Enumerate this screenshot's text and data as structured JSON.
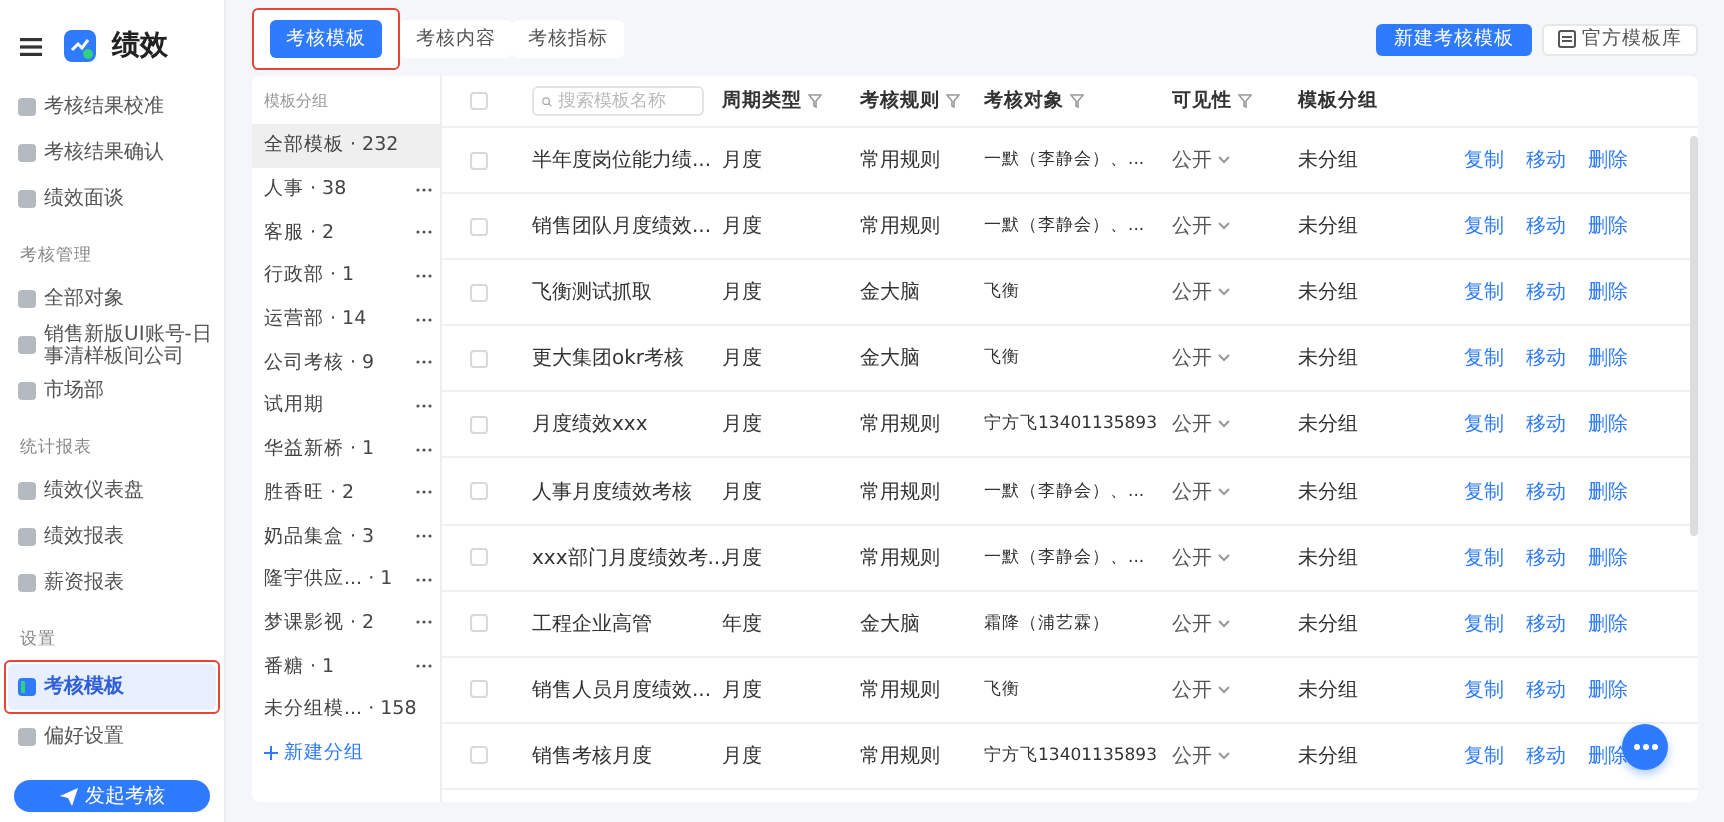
{
  "sidebar": {
    "title": "绩效",
    "items": [
      {
        "kind": "item",
        "label": "考核结果校准",
        "selected": false
      },
      {
        "kind": "item",
        "label": "考核结果确认",
        "selected": false
      },
      {
        "kind": "item",
        "label": "绩效面谈",
        "selected": false
      },
      {
        "kind": "section",
        "label": "考核管理"
      },
      {
        "kind": "item",
        "label": "全部对象",
        "selected": false
      },
      {
        "kind": "item",
        "label": "销售新版UI账号-日事清样板间公司",
        "selected": false
      },
      {
        "kind": "item",
        "label": "市场部",
        "selected": false
      },
      {
        "kind": "section",
        "label": "统计报表"
      },
      {
        "kind": "item",
        "label": "绩效仪表盘",
        "selected": false
      },
      {
        "kind": "item",
        "label": "绩效报表",
        "selected": false
      },
      {
        "kind": "item",
        "label": "薪资报表",
        "selected": false
      },
      {
        "kind": "section",
        "label": "设置"
      },
      {
        "kind": "item",
        "label": "考核模板",
        "selected": true
      },
      {
        "kind": "item",
        "label": "偏好设置",
        "selected": false
      }
    ],
    "button": "发起考核"
  },
  "tabs": [
    {
      "label": "考核模板",
      "selected": true
    },
    {
      "label": "考核内容",
      "selected": false
    },
    {
      "label": "考核指标",
      "selected": false
    }
  ],
  "toolbar": {
    "primary": "新建考核模板",
    "secondary": "官方模板库"
  },
  "groups": {
    "header": "模板分组",
    "items": [
      {
        "label": "全部模板 · 232",
        "selected": true,
        "menu": false
      },
      {
        "label": "人事 · 38",
        "selected": false,
        "menu": true
      },
      {
        "label": "客服 · 2",
        "selected": false,
        "menu": true
      },
      {
        "label": "行政部 · 1",
        "selected": false,
        "menu": true
      },
      {
        "label": "运营部 · 14",
        "selected": false,
        "menu": true
      },
      {
        "label": "公司考核 · 9",
        "selected": false,
        "menu": true
      },
      {
        "label": "试用期",
        "selected": false,
        "menu": true
      },
      {
        "label": "华益新桥 · 1",
        "selected": false,
        "menu": true
      },
      {
        "label": "胜香旺 · 2",
        "selected": false,
        "menu": true
      },
      {
        "label": "奶品集盒 · 3",
        "selected": false,
        "menu": true
      },
      {
        "label": "隆宇供应...  · 1",
        "selected": false,
        "menu": true
      },
      {
        "label": "梦课影视 · 2",
        "selected": false,
        "menu": true
      },
      {
        "label": "番糖 · 1",
        "selected": false,
        "menu": true
      },
      {
        "label": "未分组模... · 158",
        "selected": false,
        "menu": false
      }
    ],
    "add": "新建分组"
  },
  "table": {
    "select_all": false,
    "search": {
      "placeholder": "搜索模板名称"
    },
    "columns": [
      {
        "label": "周期类型",
        "filter": true
      },
      {
        "label": "考核规则",
        "filter": true
      },
      {
        "label": "考核对象",
        "filter": true
      },
      {
        "label": "可见性",
        "filter": true
      },
      {
        "label": "模板分组",
        "filter": false
      }
    ],
    "rows": [
      {
        "checked": false,
        "name": "半年度岗位能力绩...",
        "period": "月度",
        "rule": "常用规则",
        "target": "一默（李静会）、...",
        "visibility": "公开",
        "group": "未分组",
        "actions": [
          "复制",
          "移动",
          "删除"
        ]
      },
      {
        "checked": false,
        "name": "销售团队月度绩效...",
        "period": "月度",
        "rule": "常用规则",
        "target": "一默（李静会）、...",
        "visibility": "公开",
        "group": "未分组",
        "actions": [
          "复制",
          "移动",
          "删除"
        ]
      },
      {
        "checked": false,
        "name": "飞衡测试抓取",
        "period": "月度",
        "rule": "金大脑",
        "target": "飞衡",
        "visibility": "公开",
        "group": "未分组",
        "actions": [
          "复制",
          "移动",
          "删除"
        ]
      },
      {
        "checked": false,
        "name": "更大集团okr考核",
        "period": "月度",
        "rule": "金大脑",
        "target": "飞衡",
        "visibility": "公开",
        "group": "未分组",
        "actions": [
          "复制",
          "移动",
          "删除"
        ]
      },
      {
        "checked": false,
        "name": "月度绩效xxx",
        "period": "月度",
        "rule": "常用规则",
        "target": "宁方飞13401135893",
        "visibility": "公开",
        "group": "未分组",
        "actions": [
          "复制",
          "移动",
          "删除"
        ]
      },
      {
        "checked": false,
        "name": "人事月度绩效考核",
        "period": "月度",
        "rule": "常用规则",
        "target": "一默（李静会）、...",
        "visibility": "公开",
        "group": "未分组",
        "actions": [
          "复制",
          "移动",
          "删除"
        ]
      },
      {
        "checked": false,
        "name": "xxx部门月度绩效考...",
        "period": "月度",
        "rule": "常用规则",
        "target": "一默（李静会）、...",
        "visibility": "公开",
        "group": "未分组",
        "actions": [
          "复制",
          "移动",
          "删除"
        ]
      },
      {
        "checked": false,
        "name": "工程企业高管",
        "period": "年度",
        "rule": "金大脑",
        "target": "霜降（浦艺霖）",
        "visibility": "公开",
        "group": "未分组",
        "actions": [
          "复制",
          "移动",
          "删除"
        ]
      },
      {
        "checked": false,
        "name": "销售人员月度绩效...",
        "period": "月度",
        "rule": "常用规则",
        "target": "飞衡",
        "visibility": "公开",
        "group": "未分组",
        "actions": [
          "复制",
          "移动",
          "删除"
        ]
      },
      {
        "checked": false,
        "name": "销售考核月度",
        "period": "月度",
        "rule": "常用规则",
        "target": "宁方飞13401135893",
        "visibility": "公开",
        "group": "未分组",
        "actions": [
          "复制",
          "移动",
          "删除"
        ]
      }
    ]
  }
}
